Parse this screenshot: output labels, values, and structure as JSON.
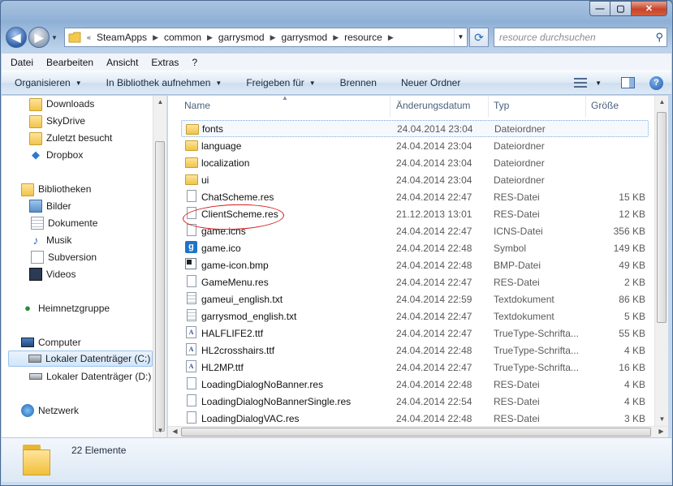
{
  "window": {
    "min": "—",
    "max": "▢",
    "close": "✕"
  },
  "address": {
    "prefix": "«",
    "crumbs": [
      "SteamApps",
      "common",
      "garrysmod",
      "garrysmod",
      "resource"
    ],
    "search_placeholder": "resource durchsuchen"
  },
  "menu": [
    "Datei",
    "Bearbeiten",
    "Ansicht",
    "Extras",
    "?"
  ],
  "toolbar": {
    "organize": "Organisieren",
    "library": "In Bibliothek aufnehmen",
    "share": "Freigeben für",
    "burn": "Brennen",
    "new_folder": "Neuer Ordner",
    "help": "?"
  },
  "nav": {
    "downloads": "Downloads",
    "skydrive": "SkyDrive",
    "recent": "Zuletzt besucht",
    "dropbox": "Dropbox",
    "libraries": "Bibliotheken",
    "pictures": "Bilder",
    "documents": "Dokumente",
    "music": "Musik",
    "subversion": "Subversion",
    "videos": "Videos",
    "homegroup": "Heimnetzgruppe",
    "computer": "Computer",
    "drive_c": "Lokaler Datenträger (C:)",
    "drive_d": "Lokaler Datenträger (D:)",
    "network": "Netzwerk"
  },
  "columns": {
    "name": "Name",
    "date": "Änderungsdatum",
    "type": "Typ",
    "size": "Größe"
  },
  "files": [
    {
      "name": "fonts",
      "date": "24.04.2014 23:04",
      "type": "Dateiordner",
      "size": "",
      "icon": "folder-icon"
    },
    {
      "name": "language",
      "date": "24.04.2014 23:04",
      "type": "Dateiordner",
      "size": "",
      "icon": "folder-icon"
    },
    {
      "name": "localization",
      "date": "24.04.2014 23:04",
      "type": "Dateiordner",
      "size": "",
      "icon": "folder-icon"
    },
    {
      "name": "ui",
      "date": "24.04.2014 23:04",
      "type": "Dateiordner",
      "size": "",
      "icon": "folder-icon"
    },
    {
      "name": "ChatScheme.res",
      "date": "24.04.2014 22:47",
      "type": "RES-Datei",
      "size": "15 KB",
      "icon": "document-icon"
    },
    {
      "name": "ClientScheme.res",
      "date": "21.12.2013 13:01",
      "type": "RES-Datei",
      "size": "12 KB",
      "icon": "document-icon"
    },
    {
      "name": "game.icns",
      "date": "24.04.2014 22:47",
      "type": "ICNS-Datei",
      "size": "356 KB",
      "icon": "document-icon"
    },
    {
      "name": "game.ico",
      "date": "24.04.2014 22:48",
      "type": "Symbol",
      "size": "149 KB",
      "icon": "gmod-icon"
    },
    {
      "name": "game-icon.bmp",
      "date": "24.04.2014 22:48",
      "type": "BMP-Datei",
      "size": "49 KB",
      "icon": "bitmap-icon"
    },
    {
      "name": "GameMenu.res",
      "date": "24.04.2014 22:47",
      "type": "RES-Datei",
      "size": "2 KB",
      "icon": "document-icon"
    },
    {
      "name": "gameui_english.txt",
      "date": "24.04.2014 22:59",
      "type": "Textdokument",
      "size": "86 KB",
      "icon": "text-document-icon"
    },
    {
      "name": "garrysmod_english.txt",
      "date": "24.04.2014 22:47",
      "type": "Textdokument",
      "size": "5 KB",
      "icon": "text-document-icon"
    },
    {
      "name": "HALFLIFE2.ttf",
      "date": "24.04.2014 22:47",
      "type": "TrueType-Schrifta...",
      "size": "55 KB",
      "icon": "font-icon"
    },
    {
      "name": "HL2crosshairs.ttf",
      "date": "24.04.2014 22:48",
      "type": "TrueType-Schrifta...",
      "size": "4 KB",
      "icon": "font-icon"
    },
    {
      "name": "HL2MP.ttf",
      "date": "24.04.2014 22:47",
      "type": "TrueType-Schrifta...",
      "size": "16 KB",
      "icon": "font-icon"
    },
    {
      "name": "LoadingDialogNoBanner.res",
      "date": "24.04.2014 22:48",
      "type": "RES-Datei",
      "size": "4 KB",
      "icon": "document-icon"
    },
    {
      "name": "LoadingDialogNoBannerSingle.res",
      "date": "24.04.2014 22:54",
      "type": "RES-Datei",
      "size": "4 KB",
      "icon": "document-icon"
    },
    {
      "name": "LoadingDialogVAC.res",
      "date": "24.04.2014 22:48",
      "type": "RES-Datei",
      "size": "3 KB",
      "icon": "document-icon"
    }
  ],
  "status": {
    "count": "22 Elemente"
  },
  "colors": {
    "annotation_circle": "#d21818",
    "selection": "#d2e5fa"
  }
}
